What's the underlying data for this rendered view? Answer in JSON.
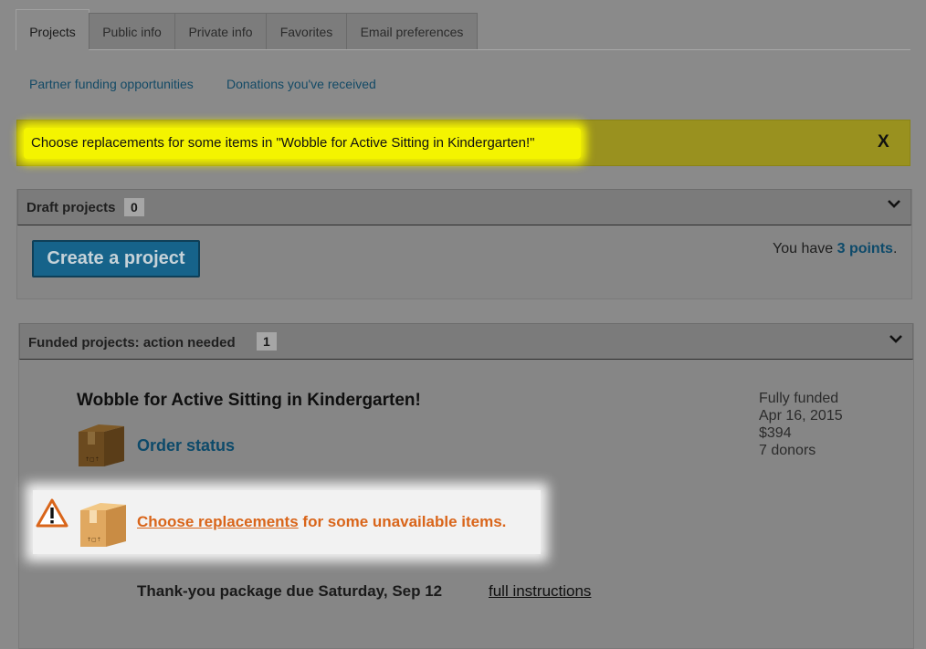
{
  "tabs": [
    "Projects",
    "Public info",
    "Private info",
    "Favorites",
    "Email preferences"
  ],
  "sublinks": [
    "Partner funding opportunities",
    "Donations you've received"
  ],
  "alert": {
    "text": "Choose replacements for some items in \"Wobble for Active Sitting in Kindergarten!\"",
    "close": "X"
  },
  "draft": {
    "title": "Draft projects",
    "count": "0",
    "create_button": "Create a project",
    "points_prefix": "You have ",
    "points_link": "3 points",
    "points_suffix": "."
  },
  "funded": {
    "title": "Funded projects: action needed",
    "count": "1",
    "project_title": "Wobble for Active Sitting in Kindergarten!",
    "order_status": "Order status",
    "meta": [
      "Fully funded",
      "Apr 16, 2015",
      "$394",
      "7 donors"
    ],
    "replace_link": "Choose replacements",
    "replace_rest": " for some unavailable items.",
    "thankyou_text": "Thank-you package due Saturday, Sep 12",
    "instructions_link": "full instructions"
  },
  "colors": {
    "accent_blue": "#0d4a6a",
    "alert_yellow": "#f4f400",
    "warning_orange": "#d9651a"
  },
  "icons": [
    "chevron-down-icon",
    "box-icon",
    "warning-icon",
    "close-icon"
  ]
}
